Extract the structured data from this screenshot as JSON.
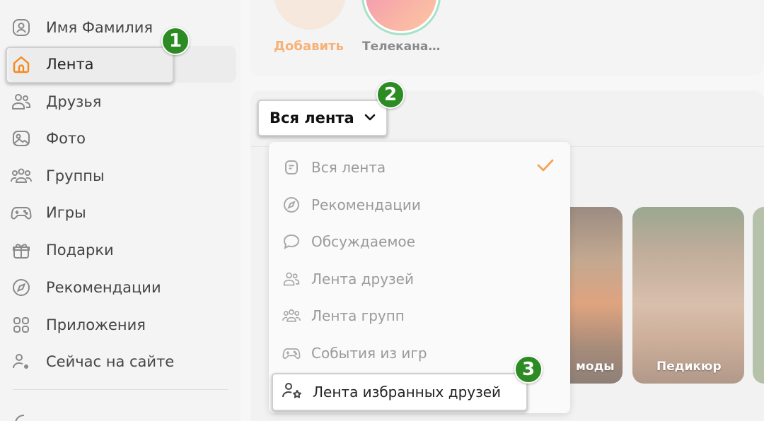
{
  "sidebar": {
    "items": [
      {
        "label": "Имя Фамилия",
        "icon": "user-icon"
      },
      {
        "label": "Лента",
        "icon": "home-icon",
        "active": true
      },
      {
        "label": "Друзья",
        "icon": "friends-icon"
      },
      {
        "label": "Фото",
        "icon": "photo-icon"
      },
      {
        "label": "Группы",
        "icon": "groups-icon"
      },
      {
        "label": "Игры",
        "icon": "gamepad-icon"
      },
      {
        "label": "Подарки",
        "icon": "gift-icon"
      },
      {
        "label": "Рекомендации",
        "icon": "compass-icon"
      },
      {
        "label": "Приложения",
        "icon": "apps-icon"
      },
      {
        "label": "Сейчас на сайте",
        "icon": "online-user-icon"
      }
    ]
  },
  "stories": {
    "add_label": "Добавить",
    "tv_label": "Телекана…"
  },
  "feed_selector": {
    "label": "Вся лента"
  },
  "dropdown": {
    "items": [
      {
        "label": "Вся лента",
        "icon": "document-icon",
        "checked": true
      },
      {
        "label": "Рекомендации",
        "icon": "compass-icon"
      },
      {
        "label": "Обсуждаемое",
        "icon": "chat-bubble-icon"
      },
      {
        "label": "Лента друзей",
        "icon": "friends-icon"
      },
      {
        "label": "Лента групп",
        "icon": "groups-icon"
      },
      {
        "label": "События из игр",
        "icon": "gamepad-icon"
      },
      {
        "label": "Лента избранных друзей",
        "icon": "favorite-friend-icon"
      }
    ]
  },
  "cards": {
    "fashion_label": "моды",
    "pedicure_label": "Педикюр"
  },
  "badges": [
    "1",
    "2",
    "3"
  ],
  "colors": {
    "accent_orange": "#f58a1f",
    "badge_green": "#2c8b22",
    "check_orange": "#f7a35c"
  }
}
